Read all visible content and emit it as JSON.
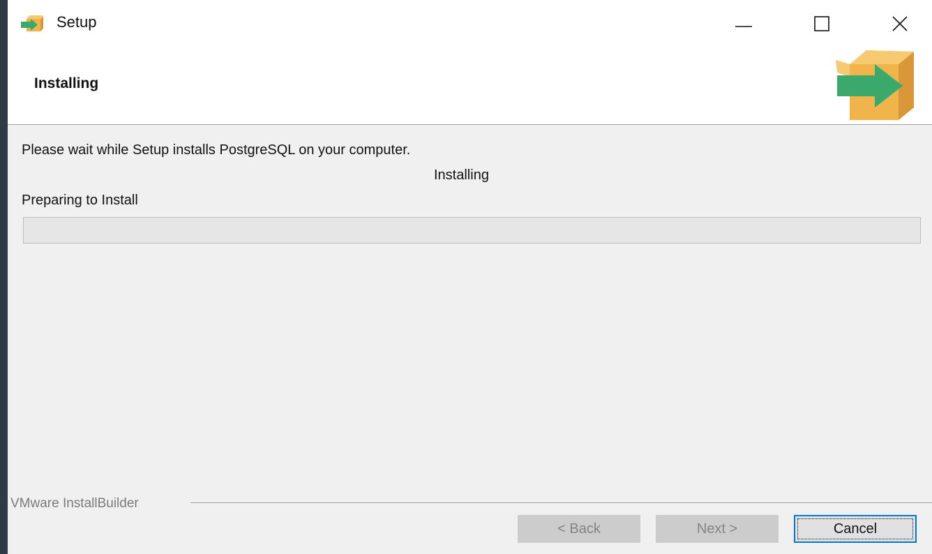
{
  "window": {
    "title": "Setup",
    "app_icon": "installer-box-arrow-icon",
    "controls": {
      "minimize_icon": "minimize-icon",
      "maximize_icon": "maximize-icon",
      "close_icon": "close-icon"
    }
  },
  "header": {
    "title": "Installing",
    "logo_icon": "installer-box-arrow-icon"
  },
  "main": {
    "description": "Please wait while Setup installs PostgreSQL on your computer.",
    "status": "Installing",
    "step_label": "Preparing to Install",
    "progress": 0
  },
  "footer": {
    "brand": "VMware InstallBuilder",
    "buttons": {
      "back": "< Back",
      "next": "Next >",
      "cancel": "Cancel"
    }
  },
  "colors": {
    "window_bg": "#f0f0f0",
    "header_bg": "#ffffff",
    "desktop_bg": "#2e3a46",
    "icon_box": "#f0b44a",
    "icon_arrow": "#3aa96b",
    "focus_border": "#0078d7"
  }
}
